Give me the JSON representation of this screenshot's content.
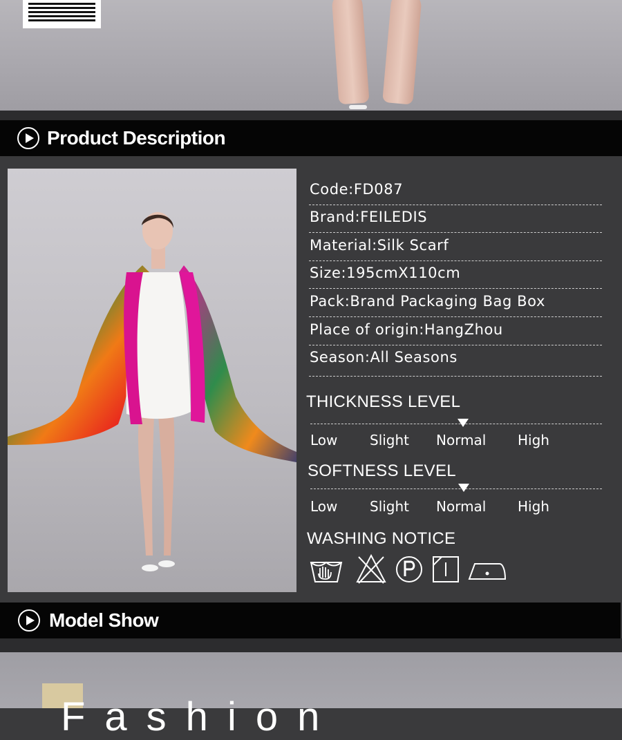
{
  "sections": {
    "product_description": "Product Description",
    "model_show": "Model Show"
  },
  "specs": [
    "Code:FD087",
    "Brand:FEILEDIS",
    "Material:Silk Scarf",
    "Size:195cmX110cm",
    "Pack:Brand Packaging Bag Box",
    "Place of origin:HangZhou",
    "Season:All Seasons"
  ],
  "thickness": {
    "title": "THICKNESS LEVEL",
    "levels": [
      "Low",
      "Slight",
      "Normal",
      "High"
    ],
    "selected": "Normal"
  },
  "softness": {
    "title": "SOFTNESS LEVEL",
    "levels": [
      "Low",
      "Slight",
      "Normal",
      "High"
    ],
    "selected": "Normal"
  },
  "washing": {
    "title": "WASHING NOTICE",
    "icons": [
      "hand-wash-icon",
      "do-not-bleach-icon",
      "dry-clean-p-icon",
      "line-dry-icon",
      "iron-low-icon"
    ]
  },
  "bottom_banner": {
    "text": "Fashion"
  },
  "colors": {
    "page_bg": "#3a3a3c",
    "header_bg": "#050505",
    "text": "#ffffff",
    "scarf_pink": "#e0169a"
  }
}
